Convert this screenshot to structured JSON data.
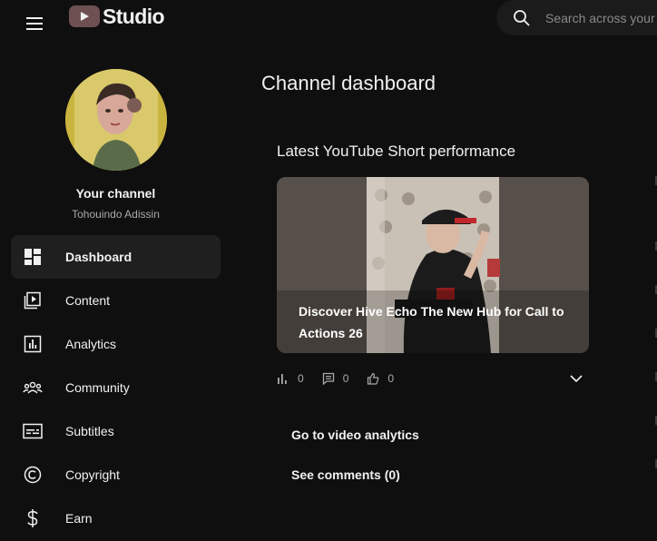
{
  "header": {
    "logo_text": "Studio",
    "search_placeholder": "Search across your channel"
  },
  "sidebar": {
    "channel_title": "Your channel",
    "channel_name": "Tohouindo Adissin",
    "items": [
      {
        "label": "Dashboard",
        "icon": "dashboard-icon",
        "active": true
      },
      {
        "label": "Content",
        "icon": "content-icon",
        "active": false
      },
      {
        "label": "Analytics",
        "icon": "analytics-icon",
        "active": false
      },
      {
        "label": "Community",
        "icon": "community-icon",
        "active": false
      },
      {
        "label": "Subtitles",
        "icon": "subtitles-icon",
        "active": false
      },
      {
        "label": "Copyright",
        "icon": "copyright-icon",
        "active": false
      },
      {
        "label": "Earn",
        "icon": "earn-icon",
        "active": false
      }
    ]
  },
  "main": {
    "page_title": "Channel dashboard",
    "card": {
      "title": "Latest YouTube Short performance",
      "video_title": "Discover Hive Echo The New Hub for Call to Actions 26",
      "views": "0",
      "comments": "0",
      "likes": "0",
      "analytics_button": "Go to video analytics",
      "comments_button": "See comments (0)"
    }
  },
  "colors": {
    "background": "#0f0f0f",
    "active_nav": "#1f1f1f",
    "logo_play": "#6e5052",
    "secondary_text": "#aaaaaa"
  }
}
